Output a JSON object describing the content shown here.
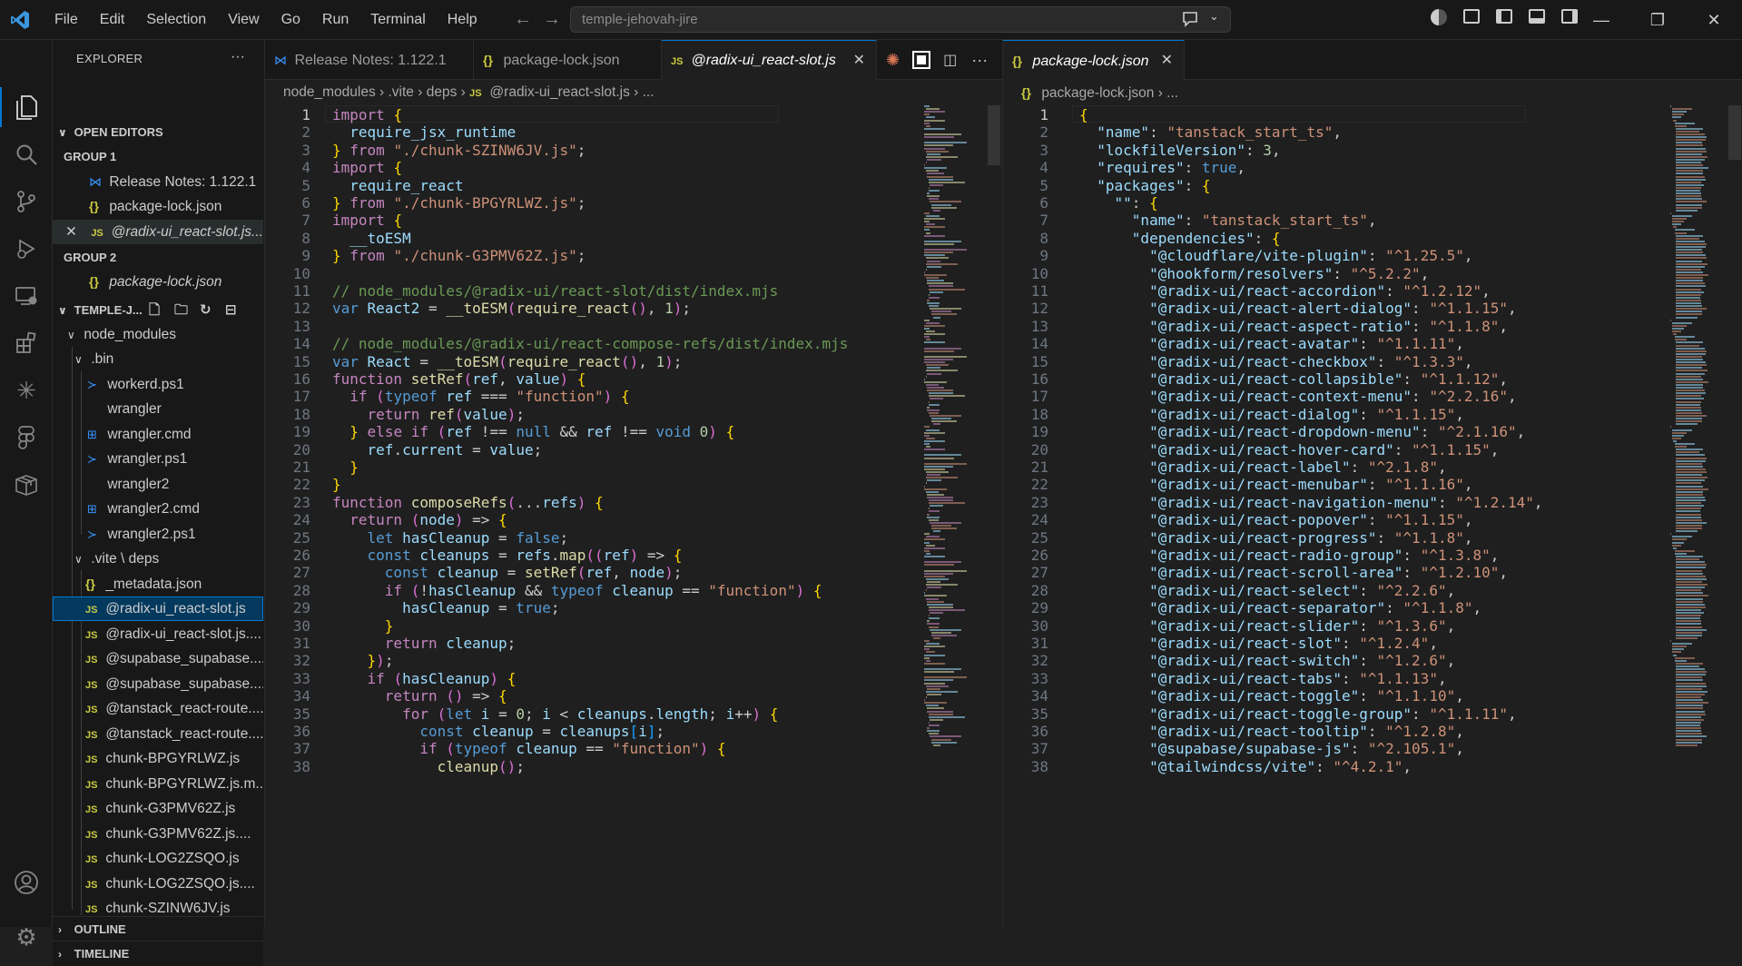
{
  "menu": [
    "File",
    "Edit",
    "Selection",
    "View",
    "Go",
    "Run",
    "Terminal",
    "Help"
  ],
  "command_center": "temple-jehovah-jire",
  "explorer": {
    "title": "EXPLORER",
    "open_editors_label": "OPEN EDITORS",
    "group1_label": "GROUP 1",
    "group1_items": [
      "Release Notes: 1.122.1",
      "package-lock.json",
      "@radix-ui_react-slot.js..."
    ],
    "group2_label": "GROUP 2",
    "group2_items": [
      "package-lock.json"
    ],
    "project_label": "TEMPLE-J...",
    "tree": [
      "node_modules",
      ".bin",
      "workerd.ps1",
      "wrangler",
      "wrangler.cmd",
      "wrangler.ps1",
      "wrangler2",
      "wrangler2.cmd",
      "wrangler2.ps1",
      ".vite \\ deps",
      "_metadata.json",
      "@radix-ui_react-slot.js",
      "@radix-ui_react-slot.js....",
      "@supabase_supabase....",
      "@supabase_supabase....",
      "@tanstack_react-route....",
      "@tanstack_react-route....",
      "chunk-BPGYRLWZ.js",
      "chunk-BPGYRLWZ.js.m...",
      "chunk-G3PMV62Z.js",
      "chunk-G3PMV62Z.js....",
      "chunk-LOG2ZSQO.js",
      "chunk-LOG2ZSQO.js....",
      "chunk-SZINW6JV.js"
    ],
    "outline_label": "OUTLINE",
    "timeline_label": "TIMELINE"
  },
  "editor1": {
    "tabs": [
      "Release Notes: 1.122.1",
      "package-lock.json",
      "@radix-ui_react-slot.js"
    ],
    "breadcrumb": [
      "node_modules",
      ".vite",
      "deps",
      "@radix-ui_react-slot.js",
      "..."
    ],
    "lines": [
      "import {",
      "  require_jsx_runtime",
      "} from \"./chunk-SZINW6JV.js\";",
      "import {",
      "  require_react",
      "} from \"./chunk-BPGYRLWZ.js\";",
      "import {",
      "  __toESM",
      "} from \"./chunk-G3PMV62Z.js\";",
      "",
      "// node_modules/@radix-ui/react-slot/dist/index.mjs",
      "var React2 = __toESM(require_react(), 1);",
      "",
      "// node_modules/@radix-ui/react-compose-refs/dist/index.mjs",
      "var React = __toESM(require_react(), 1);",
      "function setRef(ref, value) {",
      "  if (typeof ref === \"function\") {",
      "    return ref(value);",
      "  } else if (ref !== null && ref !== void 0) {",
      "    ref.current = value;",
      "  }",
      "}",
      "function composeRefs(...refs) {",
      "  return (node) => {",
      "    let hasCleanup = false;",
      "    const cleanups = refs.map((ref) => {",
      "      const cleanup = setRef(ref, node);",
      "      if (!hasCleanup && typeof cleanup == \"function\") {",
      "        hasCleanup = true;",
      "      }",
      "      return cleanup;",
      "    });",
      "    if (hasCleanup) {",
      "      return () => {",
      "        for (let i = 0; i < cleanups.length; i++) {",
      "          const cleanup = cleanups[i];",
      "          if (typeof cleanup == \"function\") {",
      "            cleanup();"
    ]
  },
  "editor2": {
    "tabs": [
      "package-lock.json"
    ],
    "breadcrumb": [
      "package-lock.json",
      "..."
    ],
    "lines": [
      "{",
      "  \"name\": \"tanstack_start_ts\",",
      "  \"lockfileVersion\": 3,",
      "  \"requires\": true,",
      "  \"packages\": {",
      "    \"\": {",
      "      \"name\": \"tanstack_start_ts\",",
      "      \"dependencies\": {",
      "        \"@cloudflare/vite-plugin\": \"^1.25.5\",",
      "        \"@hookform/resolvers\": \"^5.2.2\",",
      "        \"@radix-ui/react-accordion\": \"^1.2.12\",",
      "        \"@radix-ui/react-alert-dialog\": \"^1.1.15\",",
      "        \"@radix-ui/react-aspect-ratio\": \"^1.1.8\",",
      "        \"@radix-ui/react-avatar\": \"^1.1.11\",",
      "        \"@radix-ui/react-checkbox\": \"^1.3.3\",",
      "        \"@radix-ui/react-collapsible\": \"^1.1.12\",",
      "        \"@radix-ui/react-context-menu\": \"^2.2.16\",",
      "        \"@radix-ui/react-dialog\": \"^1.1.15\",",
      "        \"@radix-ui/react-dropdown-menu\": \"^2.1.16\",",
      "        \"@radix-ui/react-hover-card\": \"^1.1.15\",",
      "        \"@radix-ui/react-label\": \"^2.1.8\",",
      "        \"@radix-ui/react-menubar\": \"^1.1.16\",",
      "        \"@radix-ui/react-navigation-menu\": \"^1.2.14\",",
      "        \"@radix-ui/react-popover\": \"^1.1.15\",",
      "        \"@radix-ui/react-progress\": \"^1.1.8\",",
      "        \"@radix-ui/react-radio-group\": \"^1.3.8\",",
      "        \"@radix-ui/react-scroll-area\": \"^1.2.10\",",
      "        \"@radix-ui/react-select\": \"^2.2.6\",",
      "        \"@radix-ui/react-separator\": \"^1.1.8\",",
      "        \"@radix-ui/react-slider\": \"^1.3.6\",",
      "        \"@radix-ui/react-slot\": \"^1.2.4\",",
      "        \"@radix-ui/react-switch\": \"^1.2.6\",",
      "        \"@radix-ui/react-tabs\": \"^1.1.13\",",
      "        \"@radix-ui/react-toggle\": \"^1.1.10\",",
      "        \"@radix-ui/react-toggle-group\": \"^1.1.11\",",
      "        \"@radix-ui/react-tooltip\": \"^1.2.8\",",
      "        \"@supabase/supabase-js\": \"^2.105.1\",",
      "        \"@tailwindcss/vite\": \"^4.2.1\","
    ]
  }
}
